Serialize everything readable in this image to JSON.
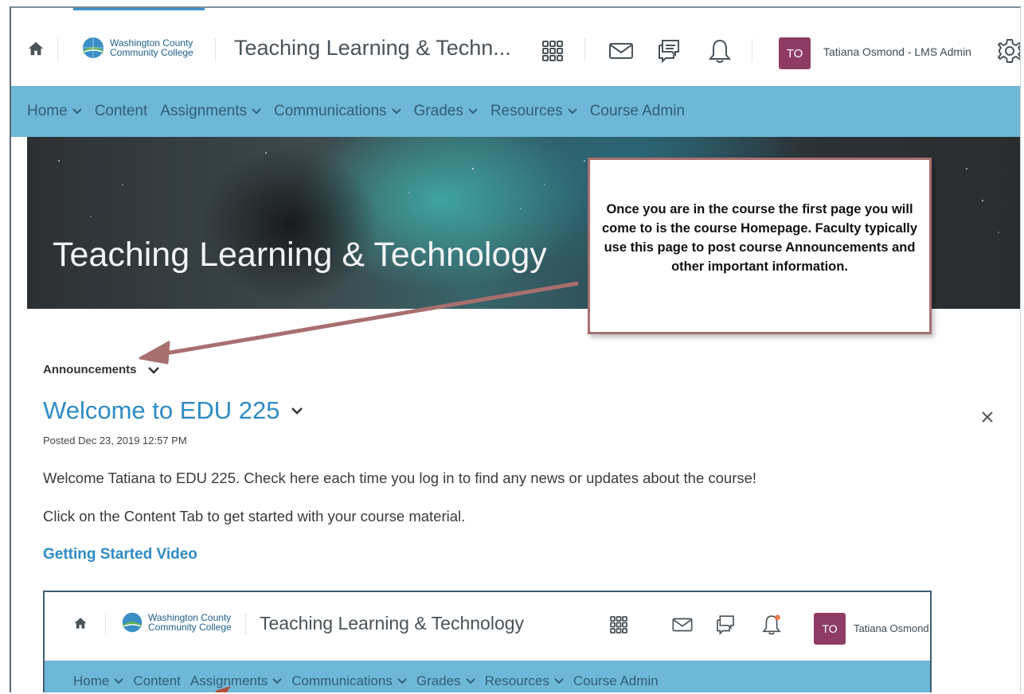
{
  "header": {
    "logo_line1": "Washington County",
    "logo_line2": "Community College",
    "course_title": "Teaching Learning & Techn...",
    "avatar_initials": "TO",
    "user_name": "Tatiana Osmond - LMS Admin"
  },
  "nav": {
    "items": [
      {
        "label": "Home",
        "has_menu": true
      },
      {
        "label": "Content",
        "has_menu": false
      },
      {
        "label": "Assignments",
        "has_menu": true
      },
      {
        "label": "Communications",
        "has_menu": true
      },
      {
        "label": "Grades",
        "has_menu": true
      },
      {
        "label": "Resources",
        "has_menu": true
      },
      {
        "label": "Course Admin",
        "has_menu": false
      }
    ]
  },
  "banner": {
    "title": "Teaching Learning & Technology"
  },
  "callout": {
    "text": "Once you are in the course the first page you will come to is the course Homepage. Faculty typically use this page to post course Announcements and other important information."
  },
  "announcements": {
    "label": "Announcements",
    "title": "Welcome to EDU 225",
    "posted": "Posted Dec 23, 2019 12:57 PM",
    "paragraph1": "Welcome Tatiana to EDU 225. Check here each time you log in to find any news or updates about the course!",
    "paragraph2": "Click on the Content Tab to get started with your course material.",
    "link": "Getting Started Video"
  },
  "embedded": {
    "logo_line1": "Washington County",
    "logo_line2": "Community College",
    "course_title": "Teaching Learning & Technology",
    "avatar_initials": "TO",
    "user_name": "Tatiana Osmond",
    "nav_items": [
      "Home",
      "Content",
      "Assignments",
      "Communications",
      "Grades",
      "Resources",
      "Course Admin"
    ]
  },
  "colors": {
    "nav_bg": "#6fb7d6",
    "link": "#2e8bc4",
    "avatar": "#8e3c66",
    "callout_border": "#a86f6f"
  },
  "icons": [
    "home-icon",
    "waffle-icon",
    "mail-icon",
    "chat-icon",
    "bell-icon",
    "gear-icon",
    "close-icon",
    "chevron-down-icon"
  ]
}
